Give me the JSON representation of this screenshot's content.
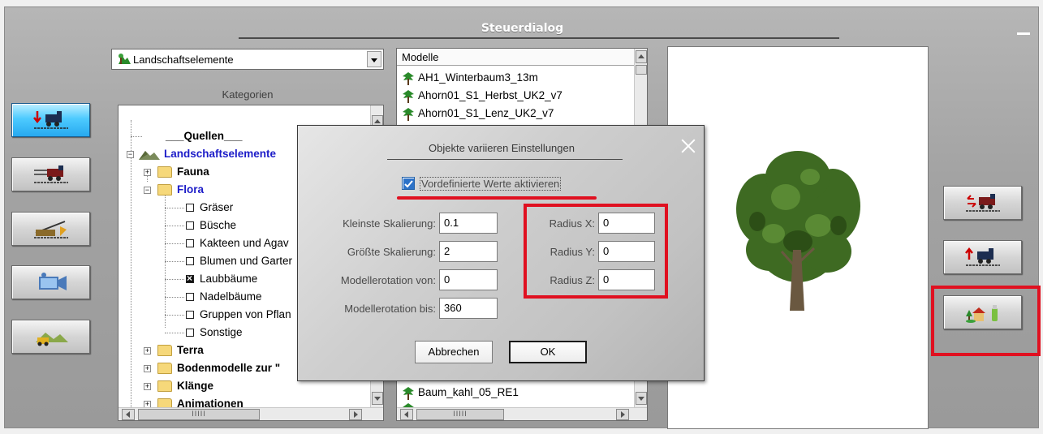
{
  "window": {
    "title": "Steuerdialog"
  },
  "category_dropdown": {
    "selected": "Landschaftselemente"
  },
  "kategorien_label": "Kategorien",
  "tree": {
    "items": [
      {
        "label": "___Quellen___"
      },
      {
        "label": "Landschaftselemente"
      },
      {
        "label": "Fauna"
      },
      {
        "label": "Flora"
      },
      {
        "label": "Gräser",
        "checked": false
      },
      {
        "label": "Büsche",
        "checked": false
      },
      {
        "label": "Kakteen und Agav",
        "checked": false
      },
      {
        "label": "Blumen und Garter",
        "checked": false
      },
      {
        "label": "Laubbäume",
        "checked": true
      },
      {
        "label": "Nadelbäume",
        "checked": false
      },
      {
        "label": "Gruppen von Pflan",
        "checked": false
      },
      {
        "label": "Sonstige",
        "checked": false
      },
      {
        "label": "Terra"
      },
      {
        "label": "Bodenmodelle zur \""
      },
      {
        "label": "Klänge"
      },
      {
        "label": "Animationen"
      }
    ]
  },
  "models": {
    "header": "Modelle",
    "items": [
      "AH1_Winterbaum3_13m",
      "Ahorn01_S1_Herbst_UK2_v7",
      "Ahorn01_S1_Lenz_UK2_v7",
      "Baum_kahl_05_RE1"
    ]
  },
  "dialog": {
    "title": "Objekte variieren Einstellungen",
    "checkbox_label": "Vordefinierte Werte aktivieren",
    "checkbox_checked": true,
    "fields": {
      "min_scale": {
        "label": "Kleinste Skalierung:",
        "value": "0.1"
      },
      "max_scale": {
        "label": "Größte Skalierung:",
        "value": "2"
      },
      "rot_from": {
        "label": "Modellerotation von:",
        "value": "0"
      },
      "rot_to": {
        "label": "Modellerotation bis:",
        "value": "360"
      },
      "radius_x": {
        "label": "Radius X:",
        "value": "0"
      },
      "radius_y": {
        "label": "Radius Y:",
        "value": "0"
      },
      "radius_z": {
        "label": "Radius Z:",
        "value": "0"
      }
    },
    "cancel_label": "Abbrechen",
    "ok_label": "OK"
  },
  "colors": {
    "highlight_red": "#e01020",
    "tree_selected_blue": "#1c1cc8",
    "active_tool_blue": "#27a9ef"
  }
}
